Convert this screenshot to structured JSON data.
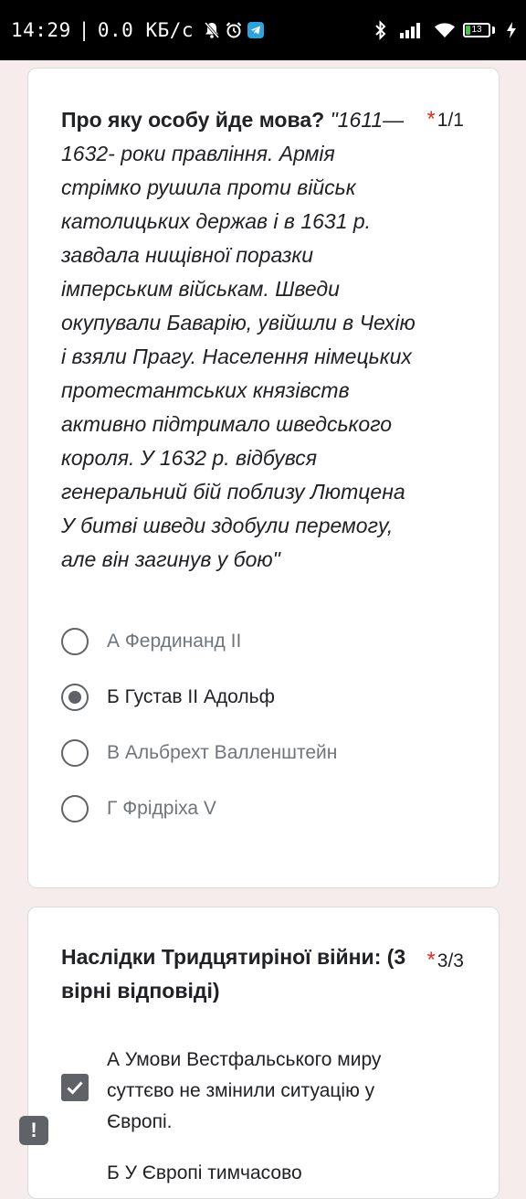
{
  "status_bar": {
    "time": "14:29",
    "separator": "|",
    "net_speed": "0.0 КБ/с",
    "battery_level": "13",
    "icons": [
      "bell-off-icon",
      "alarm-icon",
      "telegram-icon",
      "bluetooth-icon",
      "signal-icon",
      "wifi-icon",
      "battery-icon",
      "charging-icon"
    ]
  },
  "question1": {
    "title": "Про яку особу йде мова?",
    "body": "\"1611—1632- роки правління. Армія стрімко рушила проти військ католицьких держав і в 1631 р. завдала нищівної поразки імперським військам. Шведи окупували Баварію, увійшли в Чехію і взяли Прагу. Населення німецьких протестантських князівств активно підтримало шведського короля. У 1632 р. відбувся генеральний бій поблизу Лютцена У битві шведи здобули перемогу, але він загинув у бою\"",
    "required_mark": "*",
    "points": "1/1",
    "options": [
      {
        "label": "А Фердинанд II",
        "selected": false
      },
      {
        "label": "Б Густав II Адольф",
        "selected": true
      },
      {
        "label": "В Альбрехт Валленштейн",
        "selected": false
      },
      {
        "label": "Г Фрідріха V",
        "selected": false
      }
    ]
  },
  "question2": {
    "title": "Наслідки Тридцятиріної війни: (3 вірні відповіді)",
    "required_mark": "*",
    "points": "3/3",
    "options": [
      {
        "label": "А Умови Вестфальського миру суттєво не змінили ситуацію у Європі.",
        "checked": true
      },
      {
        "label": "Б У Європі тимчасово",
        "checked": false
      }
    ]
  },
  "report_button": {
    "label": "!"
  },
  "colors": {
    "background": "#f6eceb",
    "card": "#ffffff",
    "required": "#d93025",
    "control": "#5f6368",
    "battery": "#44c24a"
  }
}
